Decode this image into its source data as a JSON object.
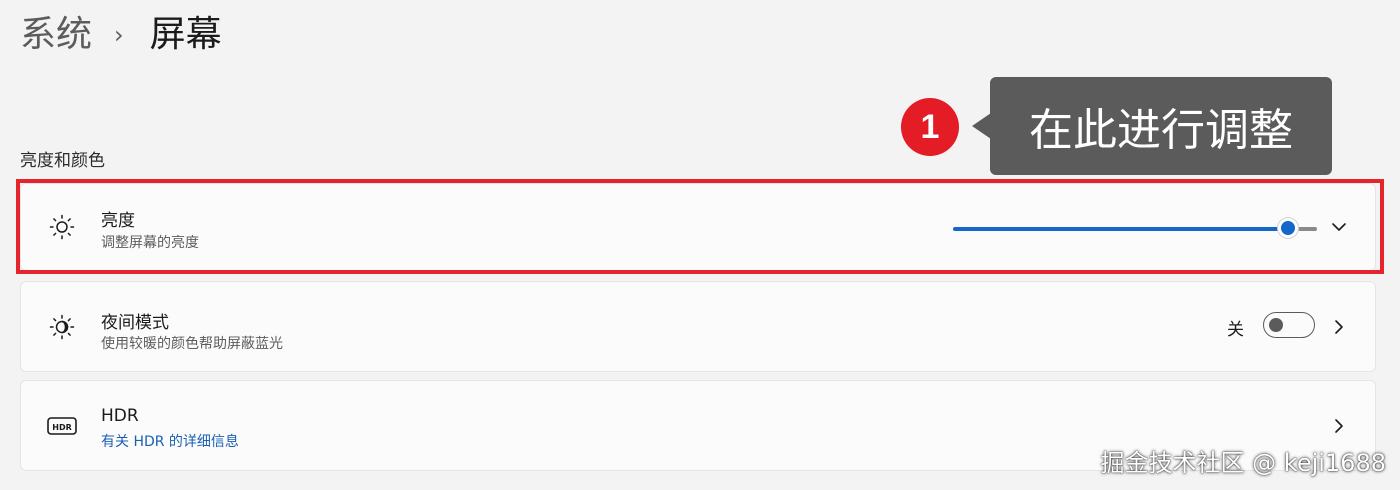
{
  "breadcrumb": {
    "parent": "系统",
    "separator": "›",
    "current": "屏幕"
  },
  "section": {
    "title": "亮度和颜色"
  },
  "callout": {
    "number": "1",
    "text": "在此进行调整"
  },
  "rows": {
    "brightness": {
      "icon": "sun-icon",
      "title": "亮度",
      "subtitle": "调整屏幕的亮度",
      "slider_value_fraction": 0.92,
      "expand_icon": "chevron-down-icon"
    },
    "night_light": {
      "icon": "night-light-icon",
      "title": "夜间模式",
      "subtitle": "使用较暖的颜色帮助屏蔽蓝光",
      "toggle_state_label": "关",
      "toggle_on": false,
      "nav_icon": "chevron-right-icon"
    },
    "hdr": {
      "icon": "hdr-icon",
      "title": "HDR",
      "subtitle": "有关 HDR 的详细信息",
      "nav_icon": "chevron-right-icon"
    }
  },
  "watermark": "掘金技术社区 @ keji1688",
  "colors": {
    "accent": "#1467c9",
    "highlight_border": "#e4262c",
    "callout_badge": "#e31c26",
    "callout_box": "#5b5b5b"
  }
}
